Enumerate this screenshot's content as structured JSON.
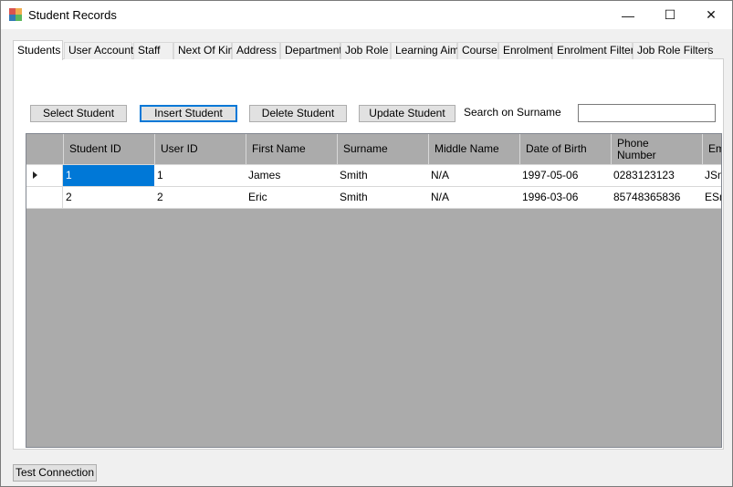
{
  "window": {
    "title": "Student Records",
    "minimize_glyph": "—",
    "maximize_glyph": "☐",
    "close_glyph": "✕",
    "icon": "app-window-icon"
  },
  "tabs": [
    {
      "label": "Students",
      "active": true
    },
    {
      "label": "User Account"
    },
    {
      "label": "Staff"
    },
    {
      "label": "Next Of Kin"
    },
    {
      "label": "Address"
    },
    {
      "label": "Department"
    },
    {
      "label": "Job Role"
    },
    {
      "label": "Learning Aim"
    },
    {
      "label": "Course"
    },
    {
      "label": "Enrolment"
    },
    {
      "label": "Enrolment Filters"
    },
    {
      "label": "Job Role Filters"
    }
  ],
  "toolbar": {
    "select_label": "Select Student",
    "insert_label": "Insert Student",
    "delete_label": "Delete Student",
    "update_label": "Update Student",
    "search_label": "Search on Surname",
    "search_value": ""
  },
  "grid": {
    "columns": [
      "Student ID",
      "User ID",
      "First Name",
      "Surname",
      "Middle Name",
      "Date of Birth",
      "Phone\nNumber",
      "Em"
    ],
    "rows": [
      [
        "1",
        "1",
        "James",
        "Smith",
        "N/A",
        "1997-05-06",
        "0283123123",
        "JSm"
      ],
      [
        "2",
        "2",
        "Eric",
        "Smith",
        "N/A",
        "1996-03-06",
        "85748365836",
        "ESm"
      ]
    ],
    "selection_color": "#0078d7",
    "empty_area_color": "#ababab"
  },
  "footer": {
    "test_connection_label": "Test Connection"
  }
}
